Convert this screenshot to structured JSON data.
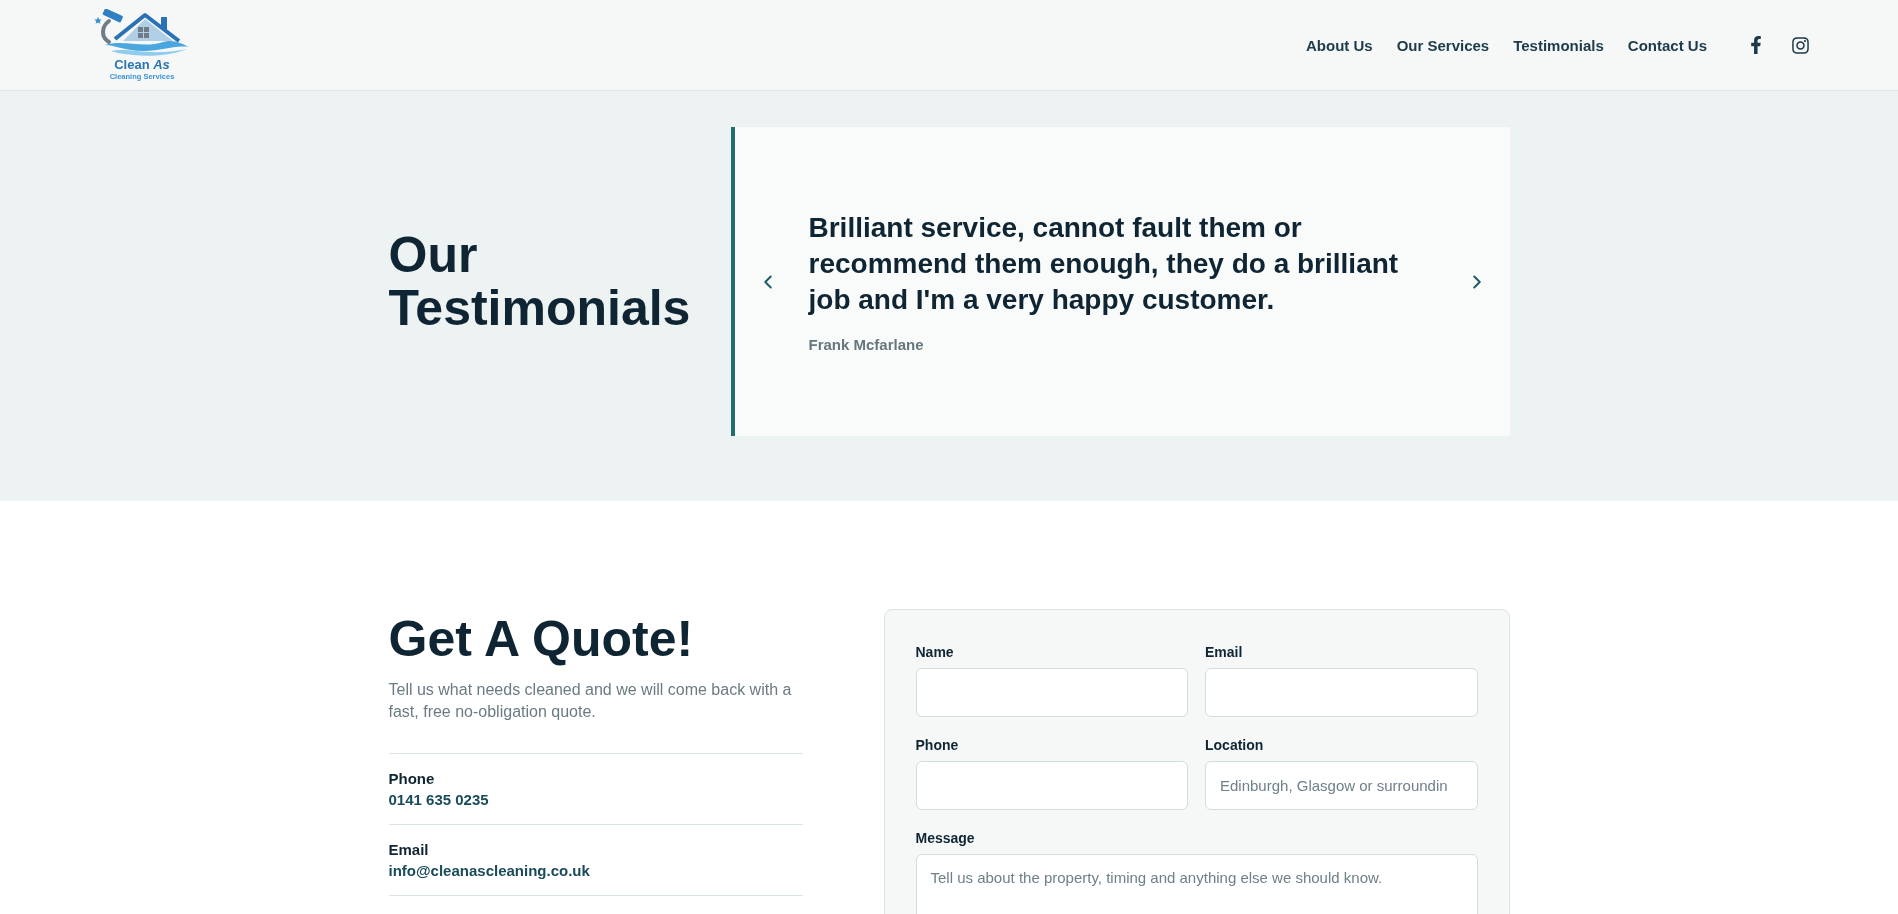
{
  "header": {
    "logo": {
      "name": "Clean *As*",
      "tagline": "Cleaning Services"
    },
    "nav": [
      {
        "label": "About Us"
      },
      {
        "label": "Our Services"
      },
      {
        "label": "Testimonials"
      },
      {
        "label": "Contact Us"
      }
    ],
    "social": [
      {
        "kind": "facebook"
      },
      {
        "kind": "instagram"
      }
    ]
  },
  "testimonials": {
    "title": "Our Testimonials",
    "quote": "Brilliant service, cannot fault them or recommend them enough, they do a brilliant job and I'm a very happy customer.",
    "author": "Frank Mcfarlane"
  },
  "quote": {
    "title": "Get A Quote!",
    "intro": "Tell us what needs cleaned and we will come back with a fast, free no-obligation quote.",
    "contacts": [
      {
        "label": "Phone",
        "value": "0141 635 0235"
      },
      {
        "label": "Email",
        "value": "info@cleanascleaning.co.uk"
      }
    ],
    "form": {
      "fields": [
        {
          "label": "Name",
          "kind": "input"
        },
        {
          "label": "Email",
          "kind": "input"
        },
        {
          "label": "Phone",
          "kind": "input"
        },
        {
          "label": "Location",
          "kind": "input",
          "placeholder": "Edinburgh, Glasgow or surroundin"
        },
        {
          "label": "Message",
          "kind": "textarea",
          "placeholder": "Tell us about the property, timing and anything else we should know."
        }
      ]
    }
  }
}
